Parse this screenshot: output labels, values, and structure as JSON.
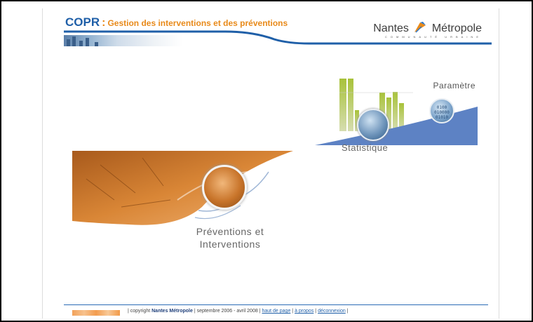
{
  "header": {
    "app_code": "COPR",
    "app_separator": ":",
    "app_full_title": "Gestion des interventions et des préventions",
    "brand_left": "Nantes",
    "brand_right": "Métropole",
    "brand_subtitle": "COMMUNAUTÉ URBAINE"
  },
  "menu": {
    "statistique_label": "Statistique",
    "parametre_label": "Paramètre",
    "binary_text": "0100 010000 01010",
    "preventions_line1": "Préventions et",
    "preventions_line2": "Interventions"
  },
  "footer": {
    "copyright_prefix": "| copyright",
    "org": "Nantes Métropole",
    "dates": "| septembre 2006 - avril 2008 |",
    "link_top": "haut de page",
    "sep1": "|",
    "link_about": "à propos",
    "sep2": "|",
    "link_logout": "déconnexion",
    "sep3": "|"
  },
  "colors": {
    "brand_blue": "#1f5fa8",
    "brand_orange": "#e88a1a",
    "wave_blue": "#5d82c4",
    "photo_orange": "#d9822b"
  }
}
